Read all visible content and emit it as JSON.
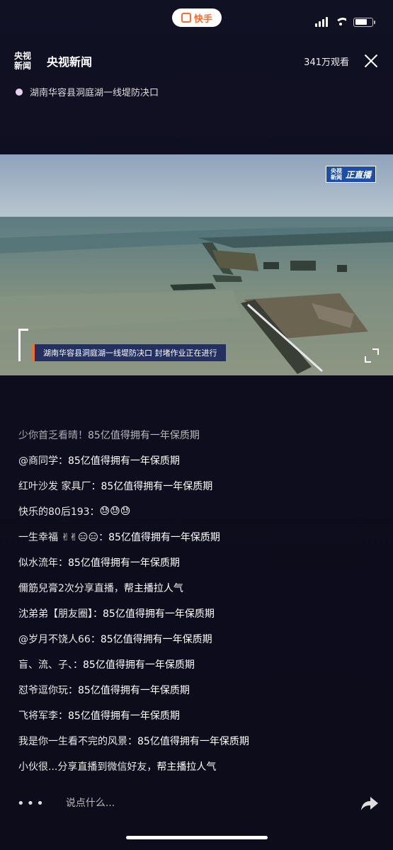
{
  "status_bar": {
    "app_pill_label": "快手"
  },
  "header": {
    "logo_line1": "央视",
    "logo_line2": "新闻",
    "channel_name": "央视新闻",
    "viewers": "341万观看"
  },
  "location": "湖南华容县洞庭湖一线堤防决口",
  "video": {
    "live_logo_line1": "央视",
    "live_logo_line2": "新闻",
    "live_label": "正直播",
    "caption": "湖南华容县洞庭湖一线堤防决口  封堵作业正在进行"
  },
  "comments": [
    {
      "user": "",
      "text": "",
      "state": "faded"
    },
    {
      "user": "少你首乏看晴！",
      "text": "85亿值得拥有一年保质期",
      "state": "half"
    },
    {
      "user": "@商同学：",
      "text": "85亿值得拥有一年保质期",
      "state": "normal"
    },
    {
      "user": "红叶沙发 家具厂：",
      "text": "85亿值得拥有一年保质期",
      "state": "normal"
    },
    {
      "user": "快乐的80后193：",
      "text": "😓😓😓",
      "state": "normal"
    },
    {
      "user": "一生幸福 ✌✌😑😑：",
      "text": "85亿值得拥有一年保质期",
      "state": "normal"
    },
    {
      "user": "似水流年：",
      "text": "85亿值得拥有一年保质期",
      "state": "normal"
    },
    {
      "user": "儞筋兒膏2次分享直播，",
      "text": "帮主播拉人气",
      "state": "normal"
    },
    {
      "user": "沈弟弟【朋友圈】：",
      "text": "85亿值得拥有一年保质期",
      "state": "normal"
    },
    {
      "user": "@岁月不饶人66：",
      "text": "85亿值得拥有一年保质期",
      "state": "normal"
    },
    {
      "user": "盲、流、子、：",
      "text": "85亿值得拥有一年保质期",
      "state": "normal"
    },
    {
      "user": "怼爷逗你玩：",
      "text": "85亿值得拥有一年保质期",
      "state": "normal"
    },
    {
      "user": "飞将军李：",
      "text": "85亿值得拥有一年保质期",
      "state": "normal"
    },
    {
      "user": "我是你一生看不完的风景：",
      "text": "85亿值得拥有一年保质期",
      "state": "normal"
    },
    {
      "user": "小伙很...分享直播到微信好友，",
      "text": "帮主播拉人气",
      "state": "normal"
    }
  ],
  "bottom_bar": {
    "more_label": "•••",
    "input_placeholder": "说点什么..."
  },
  "colors": {
    "background": "#0c0c1c",
    "accent": "#ff6a2a",
    "live_badge": "#1b4fa5"
  }
}
